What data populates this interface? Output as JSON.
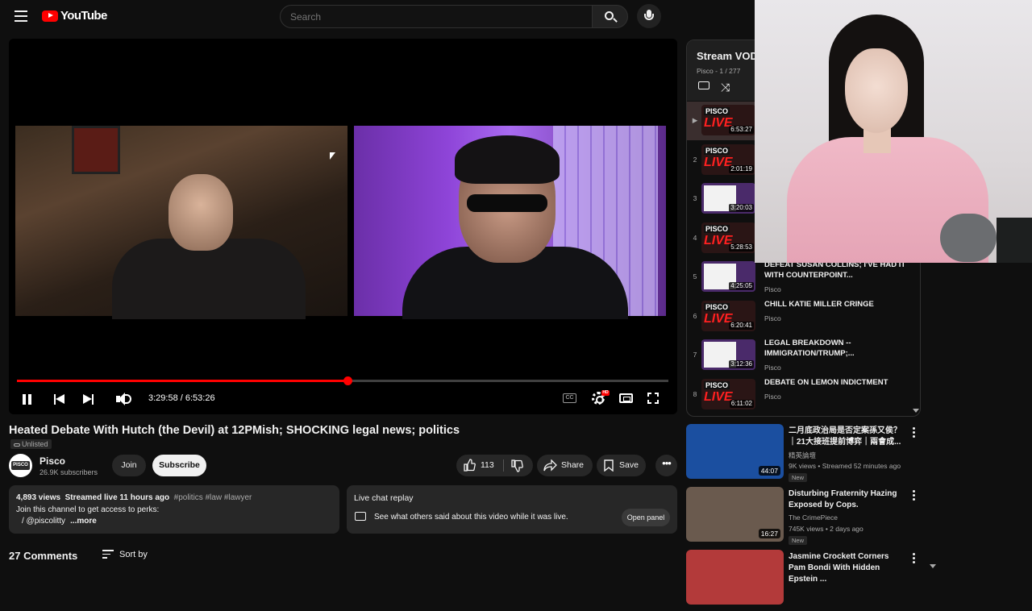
{
  "header": {
    "logo_text": "YouTube",
    "search_placeholder": "Search"
  },
  "player": {
    "time_current": "3:29:58",
    "time_total": "6:53:26",
    "time_display": "3:29:58 / 6:53:26",
    "progress_fraction": 0.5079,
    "cc_label": "CC",
    "hd_label": "HD"
  },
  "video": {
    "title": "Heated Debate With Hutch (the Devil) at 12PMish; SHOCKING legal news; politics",
    "visibility": "Unlisted",
    "channel": "Pisco",
    "subscribers": "26.9K subscribers",
    "join_label": "Join",
    "subscribe_label": "Subscribe",
    "likes": "113",
    "share_label": "Share",
    "save_label": "Save",
    "avatar_text": "PISCO"
  },
  "description": {
    "views": "4,893 views",
    "streamed": "Streamed live 11 hours ago",
    "tags": "#politics #law #lawyer",
    "line2": "Join this channel to get access to perks:",
    "line3": "/ @piscolitty",
    "more": "...more"
  },
  "live_chat": {
    "title": "Live chat replay",
    "text": "See what others said about this video while it was live.",
    "open_label": "Open panel"
  },
  "comments": {
    "count_label": "27 Comments",
    "sort_label": "Sort by"
  },
  "playlist": {
    "title": "Stream VOD",
    "subtitle": "Pisco - 1 / 277",
    "items": [
      {
        "index": "▶",
        "duration": "6:53:27",
        "title": "",
        "channel": "",
        "thumb": "pisco"
      },
      {
        "index": "2",
        "duration": "2:01:19",
        "title": "",
        "channel": "",
        "thumb": "pisco"
      },
      {
        "index": "3",
        "duration": "3:20:03",
        "title": "",
        "channel": "",
        "thumb": "doc"
      },
      {
        "index": "4",
        "duration": "5:28:53",
        "title": "",
        "channel": "",
        "thumb": "pisco"
      },
      {
        "index": "5",
        "duration": "4:25:05",
        "title": "DEFEAT SUSAN COLLINS; I'VE HAD IT WITH COUNTERPOINT...",
        "channel": "Pisco",
        "thumb": "doc"
      },
      {
        "index": "6",
        "duration": "6:20:41",
        "title": "CHILL KATIE MILLER CRINGE",
        "channel": "Pisco",
        "thumb": "pisco"
      },
      {
        "index": "7",
        "duration": "3:12:36",
        "title": "LEGAL BREAKDOWN -- IMMIGRATION/TRUMP;...",
        "channel": "Pisco",
        "thumb": "doc"
      },
      {
        "index": "8",
        "duration": "6:11:02",
        "title": "DEBATE ON LEMON INDICTMENT",
        "channel": "Pisco",
        "thumb": "pisco"
      }
    ],
    "thumb_pisco": "PISCO",
    "thumb_live": "LIVE"
  },
  "recommendations": [
    {
      "title": "二月底政治局是否定案孫又侯？｜21大接班提前博弈｜兩會成...",
      "channel": "精英論壇",
      "meta": "9K views • Streamed 52 minutes ago",
      "badge": "New",
      "duration": "44:07",
      "thumb_color": "#1b4fa0"
    },
    {
      "title": "Disturbing Fraternity Hazing Exposed by Cops.",
      "channel": "The CrimePiece",
      "meta": "745K views • 2 days ago",
      "badge": "New",
      "duration": "16:27",
      "thumb_color": "#6a5a4e"
    },
    {
      "title": "Jasmine Crockett Corners Pam Bondi With Hidden Epstein ...",
      "channel": "",
      "meta": "",
      "badge": "",
      "duration": "",
      "thumb_color": "#b33a3a"
    }
  ]
}
